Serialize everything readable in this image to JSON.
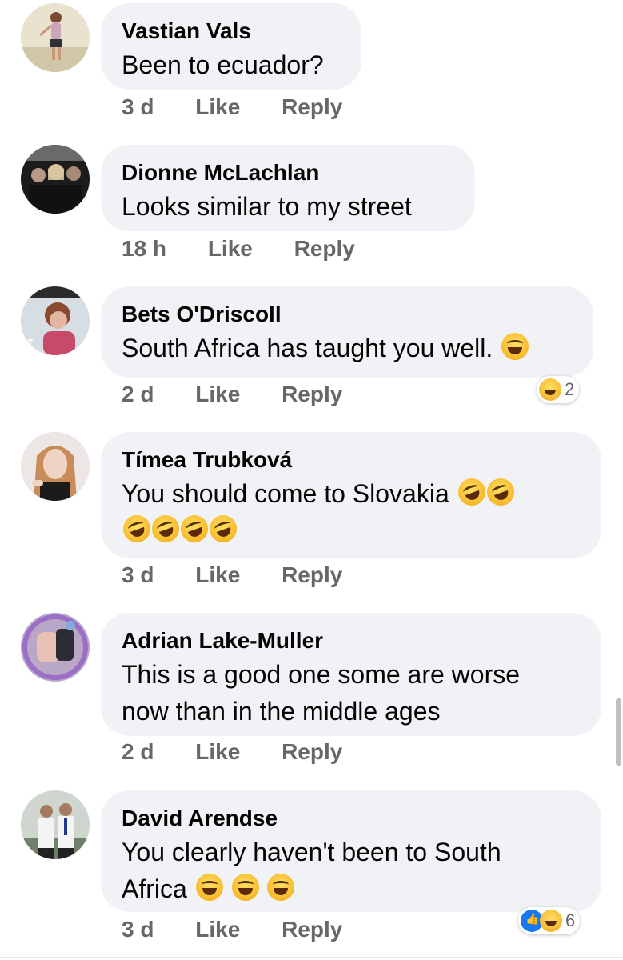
{
  "comments": [
    {
      "author": "Vastian Vals",
      "text": "Been to ecuador?",
      "time": "3 d",
      "like": "Like",
      "reply": "Reply"
    },
    {
      "author": "Dionne McLachlan",
      "text": "Looks similar to my street",
      "time": "18 h",
      "like": "Like",
      "reply": "Reply"
    },
    {
      "author": "Bets O'Driscoll",
      "text": "South Africa has taught you well.",
      "time": "2 d",
      "like": "Like",
      "reply": "Reply",
      "reaction_count": "2"
    },
    {
      "author": "Tímea Trubková",
      "text": "You should come to Slovakia",
      "time": "3 d",
      "like": "Like",
      "reply": "Reply"
    },
    {
      "author": "Adrian Lake-Muller",
      "text_line1": "This is a good one some are worse",
      "text_line2": "now than in the middle ages",
      "time": "2 d",
      "like": "Like",
      "reply": "Reply"
    },
    {
      "author": "David Arendse",
      "text_line1": "You clearly haven't been to South",
      "text_line2": "Africa",
      "time": "3 d",
      "like": "Like",
      "reply": "Reply",
      "reaction_count": "6"
    }
  ],
  "icons": {
    "laughing_emoji": "face-with-tears-of-joy-icon",
    "rofl_emoji": "rolling-on-floor-laughing-icon",
    "haha_reaction": "haha-reaction-icon",
    "like_reaction": "like-reaction-icon"
  },
  "colors": {
    "bubble": "#f0f2f5",
    "meta_text": "#65676b",
    "like_blue": "#1877f2",
    "emoji_yellow": "#f7b928"
  }
}
